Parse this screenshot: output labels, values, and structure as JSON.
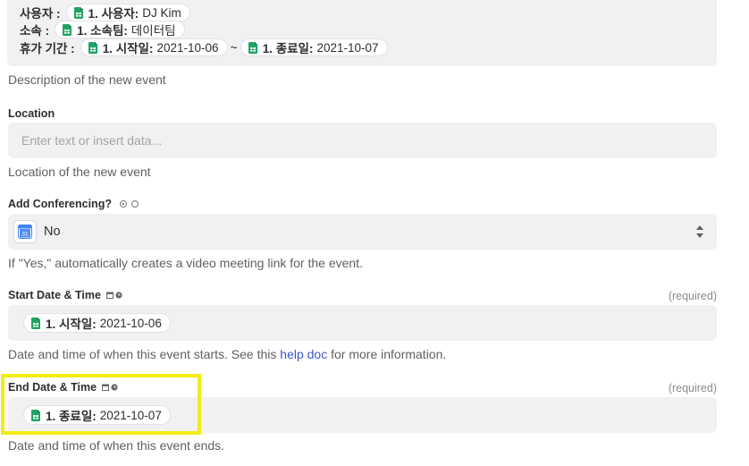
{
  "description": {
    "lines": [
      {
        "label": "사용자 :",
        "pill_key": "1. 사용자:",
        "pill_value": "DJ Kim"
      },
      {
        "label": "소속 :",
        "pill_key": "1. 소속팀:",
        "pill_value": "데이터팀"
      },
      {
        "label": "휴가 기간 :",
        "pill_key": "1. 시작일:",
        "pill_value": "2021-10-06",
        "separator": "~",
        "pill2_key": "1. 종료일:",
        "pill2_value": "2021-10-07"
      }
    ],
    "help": "Description of the new event"
  },
  "location": {
    "label": "Location",
    "placeholder": "Enter text or insert data...",
    "help": "Location of the new event"
  },
  "conferencing": {
    "label": "Add Conferencing?",
    "value": "No",
    "calendar_day": "31",
    "help": "If \"Yes,\" automatically creates a video meeting link for the event."
  },
  "start": {
    "label": "Start Date & Time",
    "required": "(required)",
    "pill_key": "1. 시작일:",
    "pill_value": "2021-10-06",
    "help_before": "Date and time of when this event starts. See this ",
    "help_link": "help doc",
    "help_after": " for more information."
  },
  "end": {
    "label": "End Date & Time",
    "required": "(required)",
    "pill_key": "1. 종료일:",
    "pill_value": "2021-10-07",
    "help": "Date and time of when this event ends."
  },
  "colors": {
    "field_bg": "#f1f1f3",
    "link": "#3e55c8",
    "highlight": "#f5ec14",
    "sheets_green": "#1fa463"
  },
  "icons": [
    "google-sheets-icon",
    "calendar-icon",
    "clock-icon",
    "radio-icon",
    "google-calendar-icon",
    "select-chevrons-icon"
  ]
}
